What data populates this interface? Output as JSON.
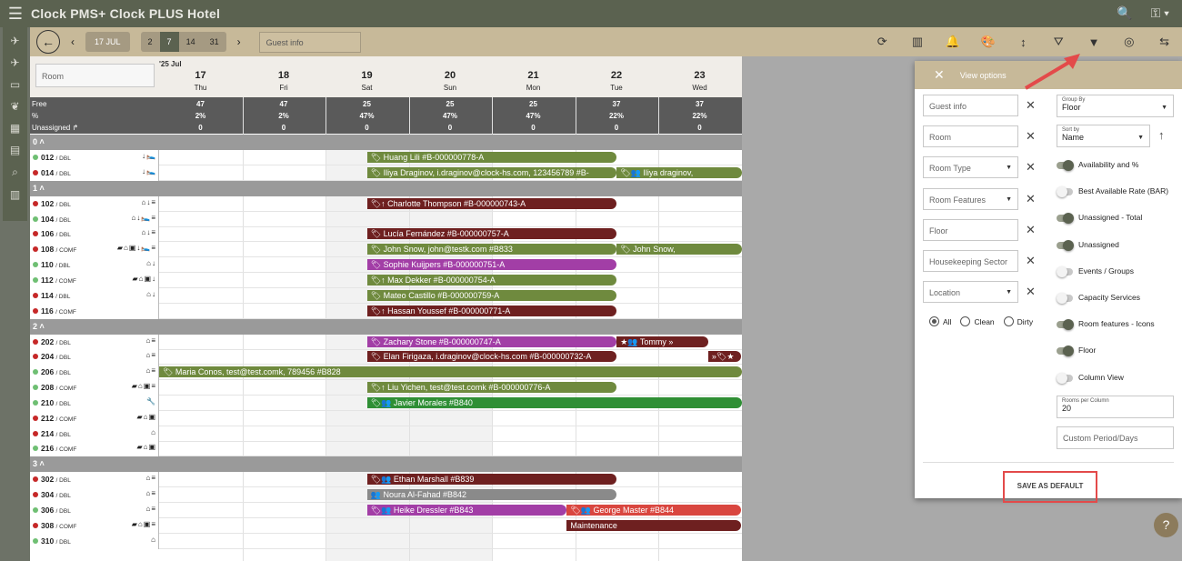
{
  "app": {
    "title": "Clock PMS+  Clock PLUS Hotel"
  },
  "toolbar": {
    "date_button": "17 JUL",
    "day_options": [
      "2",
      "7",
      "14",
      "31"
    ],
    "active_day": "7",
    "guest_placeholder": "Guest info"
  },
  "grid": {
    "room_placeholder": "Room",
    "year_month": "'25 Jul",
    "days": [
      {
        "num": "17",
        "wd": "Thu"
      },
      {
        "num": "18",
        "wd": "Fri"
      },
      {
        "num": "19",
        "wd": "Sat"
      },
      {
        "num": "20",
        "wd": "Sun"
      },
      {
        "num": "21",
        "wd": "Mon"
      },
      {
        "num": "22",
        "wd": "Tue"
      },
      {
        "num": "23",
        "wd": "Wed"
      }
    ],
    "stats": {
      "labels": [
        "Free",
        "%",
        "Unassigned ↱"
      ],
      "free": [
        "47",
        "47",
        "25",
        "25",
        "25",
        "37",
        "37"
      ],
      "pct": [
        "2%",
        "2%",
        "47%",
        "47%",
        "47%",
        "22%",
        "22%"
      ],
      "unassigned": [
        "0",
        "0",
        "0",
        "0",
        "0",
        "0",
        "0"
      ]
    },
    "groups": [
      {
        "label": "0 ˄",
        "rooms": [
          {
            "num": "012",
            "type": "/ DBL",
            "status": "green",
            "icons": "↓🛌"
          },
          {
            "num": "014",
            "type": "/ DBL",
            "status": "red",
            "icons": "↓🛌"
          }
        ]
      },
      {
        "label": "1 ˄",
        "rooms": [
          {
            "num": "102",
            "type": "/ DBL",
            "status": "red",
            "icons": "⌂↓≡"
          },
          {
            "num": "104",
            "type": "/ DBL",
            "status": "green",
            "icons": "⌂↓🛌≡"
          },
          {
            "num": "106",
            "type": "/ DBL",
            "status": "red",
            "icons": "⌂↓≡"
          },
          {
            "num": "108",
            "type": "/ COMF",
            "status": "red",
            "icons": "▰⌂▣↓🛌≡"
          },
          {
            "num": "110",
            "type": "/ DBL",
            "status": "green",
            "icons": "⌂↓"
          },
          {
            "num": "112",
            "type": "/ COMF",
            "status": "green",
            "icons": "▰⌂▣↓"
          },
          {
            "num": "114",
            "type": "/ DBL",
            "status": "red",
            "icons": "⌂↓"
          },
          {
            "num": "116",
            "type": "/ COMF",
            "status": "red",
            "icons": ""
          }
        ]
      },
      {
        "label": "2 ˄",
        "rooms": [
          {
            "num": "202",
            "type": "/ DBL",
            "status": "red",
            "icons": "⌂≡"
          },
          {
            "num": "204",
            "type": "/ DBL",
            "status": "red",
            "icons": "⌂≡"
          },
          {
            "num": "206",
            "type": "/ DBL",
            "status": "green",
            "icons": "⌂≡"
          },
          {
            "num": "208",
            "type": "/ COMF",
            "status": "green",
            "icons": "▰⌂▣≡"
          },
          {
            "num": "210",
            "type": "/ DBL",
            "status": "green",
            "icons": "🔧"
          },
          {
            "num": "212",
            "type": "/ COMF",
            "status": "red",
            "icons": "▰⌂▣"
          },
          {
            "num": "214",
            "type": "/ DBL",
            "status": "red",
            "icons": "⌂"
          },
          {
            "num": "216",
            "type": "/ COMF",
            "status": "green",
            "icons": "▰⌂▣"
          }
        ]
      },
      {
        "label": "3 ˄",
        "rooms": [
          {
            "num": "302",
            "type": "/ DBL",
            "status": "red",
            "icons": "⌂≡"
          },
          {
            "num": "304",
            "type": "/ DBL",
            "status": "red",
            "icons": "⌂≡"
          },
          {
            "num": "306",
            "type": "/ DBL",
            "status": "green",
            "icons": "⌂≡"
          },
          {
            "num": "308",
            "type": "/ COMF",
            "status": "red",
            "icons": "▰⌂▣≡"
          },
          {
            "num": "310",
            "type": "/ DBL",
            "status": "green",
            "icons": "⌂"
          }
        ]
      }
    ],
    "bookings": [
      {
        "row": 0,
        "start": 2.5,
        "end": 5.5,
        "color": "#6f8a3e",
        "text": "🏷 Huang Lili #B-000000778-A"
      },
      {
        "row": 1,
        "start": 2.5,
        "end": 5.5,
        "color": "#6f8a3e",
        "text": "🏷 Iliya Draginov, i.draginov@clock-hs.com, 123456789 #B-"
      },
      {
        "row": 1,
        "start": 5.5,
        "end": 7.0,
        "color": "#6f8a3e",
        "text": "🏷👥 Iliya draginov,"
      },
      {
        "row": 2,
        "start": 2.5,
        "end": 5.5,
        "color": "#6e2020",
        "text": "🏷↑ Charlotte Thompson #B-000000743-A"
      },
      {
        "row": 4,
        "start": 2.5,
        "end": 5.5,
        "color": "#6e2020",
        "text": "🏷 Lucía Fernández #B-000000757-A"
      },
      {
        "row": 5,
        "start": 2.5,
        "end": 5.5,
        "color": "#6f8a3e",
        "text": "🏷 John Snow, john@testk.com #B833"
      },
      {
        "row": 5,
        "start": 5.5,
        "end": 7.0,
        "color": "#6f8a3e",
        "text": "🏷 John Snow,"
      },
      {
        "row": 6,
        "start": 2.5,
        "end": 5.5,
        "color": "#a23ea6",
        "text": "🏷 Sophie Kuijpers #B-000000751-A"
      },
      {
        "row": 7,
        "start": 2.5,
        "end": 5.5,
        "color": "#6f8a3e",
        "text": "🏷↑ Max Dekker #B-000000754-A"
      },
      {
        "row": 8,
        "start": 2.5,
        "end": 5.5,
        "color": "#6f8a3e",
        "text": "🏷 Mateo Castillo #B-000000759-A"
      },
      {
        "row": 9,
        "start": 2.5,
        "end": 5.5,
        "color": "#6e2020",
        "text": "🏷↑ Hassan Youssef #B-000000771-A"
      },
      {
        "row": 10,
        "start": 2.5,
        "end": 5.5,
        "color": "#a23ea6",
        "text": "🏷 Zachary Stone #B-000000747-A"
      },
      {
        "row": 10,
        "start": 5.5,
        "end": 6.6,
        "color": "#6e2020",
        "text": "★👥 Tommy »"
      },
      {
        "row": 11,
        "start": 2.5,
        "end": 5.5,
        "color": "#6e2020",
        "text": "🏷 Elan Firigaza, i.draginov@clock-hs.com #B-000000732-A"
      },
      {
        "row": 11,
        "start": 6.6,
        "end": 7.0,
        "color": "#6e2020",
        "text": "»🏷★"
      },
      {
        "row": 12,
        "start": 0,
        "end": 7.0,
        "color": "#6f8a3e",
        "text": "🏷 Maria Conos, test@test.comk, 789456 #B828"
      },
      {
        "row": 13,
        "start": 2.5,
        "end": 5.5,
        "color": "#6f8a3e",
        "text": "🏷↑ Liu Yichen, test@test.comk #B-000000776-A"
      },
      {
        "row": 14,
        "start": 2.5,
        "end": 7.0,
        "color": "#2f8f35",
        "text": "🏷👥 Javier Morales #B840"
      },
      {
        "row": 18,
        "start": 2.5,
        "end": 5.5,
        "color": "#6e2020",
        "text": "🏷👥 Ethan Marshall #B839"
      },
      {
        "row": 19,
        "start": 2.5,
        "end": 5.5,
        "color": "#8a8a8a",
        "text": "👥 Noura Al-Fahad #B842"
      },
      {
        "row": 20,
        "start": 2.5,
        "end": 4.9,
        "color": "#a23ea6",
        "text": "🏷👥 Heike Dressler #B843"
      },
      {
        "row": 20,
        "start": 4.9,
        "end": 7.0,
        "color": "#d9463f",
        "text": "🏷👥 George Master #B844"
      },
      {
        "row": 21,
        "start": 4.9,
        "end": 7.0,
        "color": "#6e2020",
        "text": "Maintenance"
      }
    ]
  },
  "view_options": {
    "title": "View options",
    "filters": [
      {
        "label": "Guest info",
        "dropdown": false
      },
      {
        "label": "Room",
        "dropdown": false
      },
      {
        "label": "Room Type",
        "dropdown": true
      },
      {
        "label": "Room Features",
        "dropdown": true
      },
      {
        "label": "Floor",
        "dropdown": false
      },
      {
        "label": "Housekeeping Sector",
        "dropdown": false
      },
      {
        "label": "Location",
        "dropdown": true
      }
    ],
    "group_by": {
      "label": "Group By",
      "value": "Floor"
    },
    "sort_by": {
      "label": "Sort by",
      "value": "Name"
    },
    "toggles": [
      {
        "label": "Availability and %",
        "on": true
      },
      {
        "label": "Best Available Rate (BAR)",
        "on": false
      },
      {
        "label": "Unassigned - Total",
        "on": true
      },
      {
        "label": "Unassigned",
        "on": true
      },
      {
        "label": "Events / Groups",
        "on": false
      },
      {
        "label": "Capacity Services",
        "on": false
      },
      {
        "label": "Room features - Icons",
        "on": true
      },
      {
        "label": "Floor",
        "on": true
      },
      {
        "label": "Column View",
        "on": false
      }
    ],
    "rooms_per_column": {
      "label": "Rooms per Column",
      "value": "20"
    },
    "custom_period": "Custom Period/Days",
    "radios": [
      {
        "label": "All",
        "on": true
      },
      {
        "label": "Clean",
        "on": false
      },
      {
        "label": "Dirty",
        "on": false
      }
    ],
    "save_label": "SAVE AS DEFAULT"
  },
  "colors": {
    "accent": "#c7b999",
    "dark": "#5b6250",
    "green": "#6f8a3e",
    "red": "#6e2020",
    "purple": "#a23ea6"
  }
}
